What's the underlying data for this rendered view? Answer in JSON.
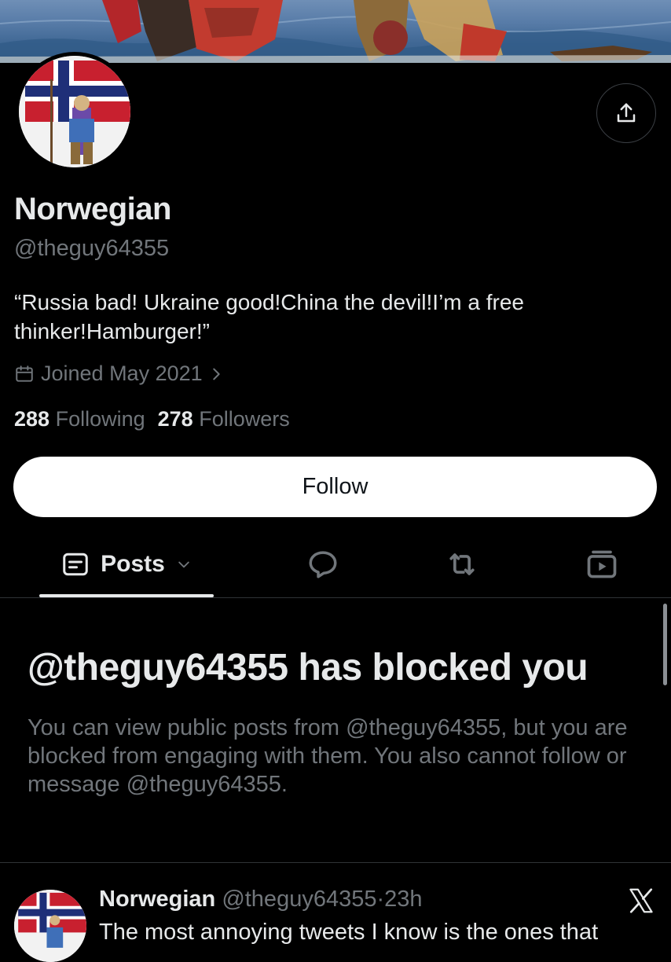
{
  "profile": {
    "display_name": "Norwegian",
    "handle": "@theguy64355",
    "bio": "“Russia bad! Ukraine good!China the devil!I’m a free thinker!Hamburger!”",
    "joined": "Joined May 2021",
    "following_count": "288",
    "following_label": "Following",
    "followers_count": "278",
    "followers_label": "Followers",
    "follow_label": "Follow"
  },
  "tabs": {
    "posts_label": "Posts",
    "icons": [
      "posts-icon",
      "chevron-down-icon",
      "reply-icon",
      "repost-icon",
      "media-icon"
    ]
  },
  "blocked": {
    "title": "@theguy64355 has blocked you",
    "message": "You can view public posts from @theguy64355, but you are blocked from engaging with them. You also cannot follow or message @theguy64355."
  },
  "post": {
    "author_name": "Norwegian",
    "author_handle": "@theguy64355",
    "separator": "·",
    "time": "23h",
    "text": "The most annoying tweets I know is the ones that"
  },
  "colors": {
    "background": "#000000",
    "primary_text": "#e7e9ea",
    "secondary_text": "#71767b",
    "border": "#2f3336",
    "follow_button_bg": "#ffffff"
  }
}
